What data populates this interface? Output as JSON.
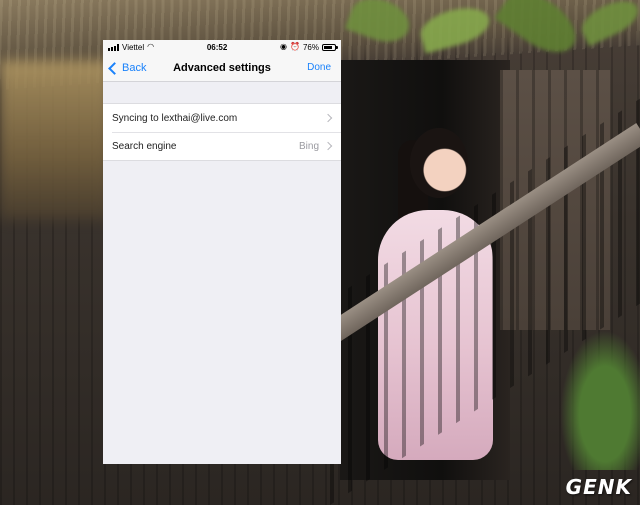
{
  "status_bar": {
    "carrier": "Viettel",
    "time": "06:52",
    "battery": "76%",
    "battery_level": 0.76
  },
  "nav": {
    "back_label": "Back",
    "title": "Advanced settings",
    "done_label": "Done"
  },
  "settings": {
    "rows": [
      {
        "label": "Syncing to lexthai@live.com",
        "value": ""
      },
      {
        "label": "Search engine",
        "value": "Bing"
      }
    ]
  },
  "watermark": "GENK",
  "colors": {
    "accent": "#1a82fb",
    "group_bg": "#efeff4"
  }
}
